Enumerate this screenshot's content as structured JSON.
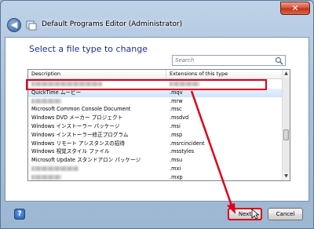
{
  "window": {
    "title": "Default Programs Editor (Administrator)",
    "close_glyph": "✕",
    "accent_close": "#c23417"
  },
  "page": {
    "heading": "Select a file type to change"
  },
  "search": {
    "placeholder": "Search"
  },
  "list": {
    "columns": {
      "description": "Description",
      "extensions": "Extensions of this type"
    },
    "rows": [
      {
        "description": "",
        "extension": "",
        "blurred": true
      },
      {
        "description": "QuickTime ムービー",
        "extension": ".mqv",
        "selected": true
      },
      {
        "description": "",
        "extension": ".mrw",
        "blurred": true
      },
      {
        "description": "Microsoft Common Console Document",
        "extension": ".msc"
      },
      {
        "description": "Windows DVD メーカー プロジェクト",
        "extension": ".msdvd"
      },
      {
        "description": "Windows インストーラー パッケージ",
        "extension": ".msi"
      },
      {
        "description": "Windows インストーラー修正プログラム",
        "extension": ".msp"
      },
      {
        "description": "Windows リモート アシスタンスの招待",
        "extension": ".msrcincident"
      },
      {
        "description": "Windows 視覚スタイル ファイル",
        "extension": ".msstyles"
      },
      {
        "description": "Microsoft Update スタンドアロン パッケージ",
        "extension": ".msu"
      },
      {
        "description": "",
        "extension": ".mxi",
        "blurred": true
      },
      {
        "description": "",
        "extension": ".mxp",
        "blurred": true
      }
    ]
  },
  "buttons": {
    "help": "?",
    "next": "Next",
    "cancel": "Cancel"
  },
  "annotation_color": "#e0001a"
}
